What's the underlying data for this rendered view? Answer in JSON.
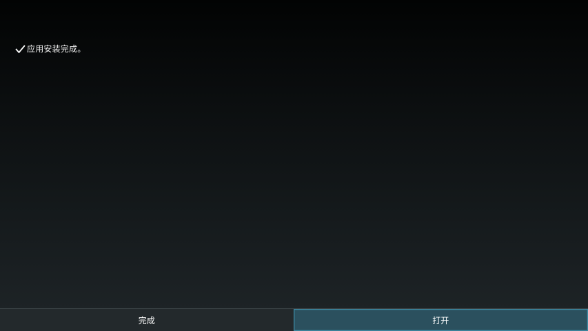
{
  "status": {
    "icon": "check-icon",
    "message": "应用安装完成。"
  },
  "buttons": {
    "done_label": "完成",
    "open_label": "打开"
  },
  "colors": {
    "focused_button": "#2b505e",
    "focused_border": "#3f8aa3"
  }
}
